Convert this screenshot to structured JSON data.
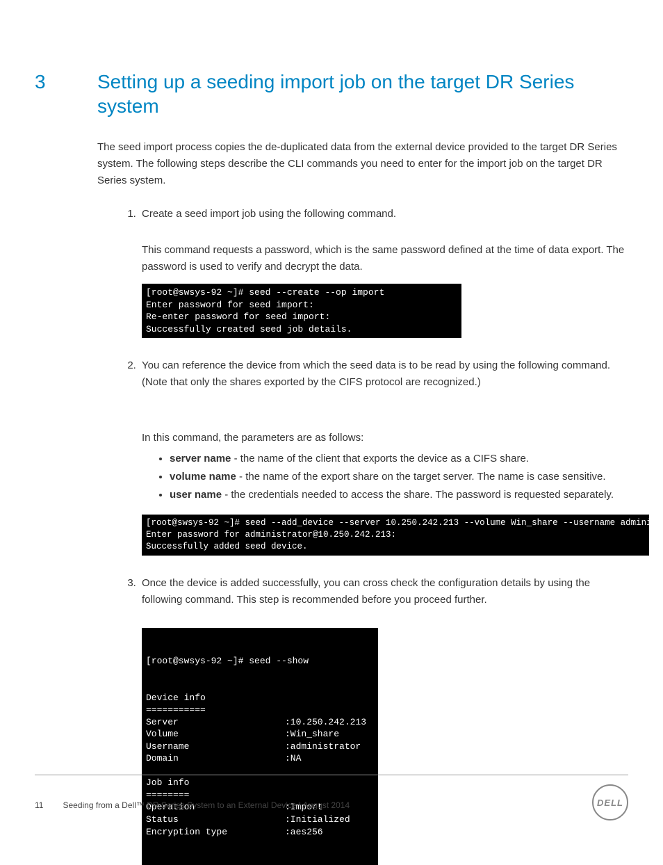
{
  "section": {
    "number": "3",
    "title": "Setting up a seeding import job on the target DR Series system"
  },
  "intro": "The seed import process copies the de-duplicated data from the external device provided to the target DR Series system. The following steps describe the CLI commands you need to enter for the import job on the target DR Series system.",
  "steps": [
    {
      "lead": "Create a seed import job using the following command.",
      "desc": "This command requests a password, which is the same password defined at the time of data export. The password is used to verify and decrypt the data.",
      "terminal": "[root@swsys-92 ~]# seed --create --op import\nEnter password for seed import:\nRe-enter password for seed import:\nSuccessfully created seed job details."
    },
    {
      "lead": "You can reference the device from which the seed data is to be read by using the following command. (Note that only the shares exported by the CIFS protocol are recognized.)",
      "param_intro": "In this command, the parameters are as follows:",
      "params": [
        {
          "name": "server name",
          "desc": " - the name of the client that exports the device as a CIFS share."
        },
        {
          "name": "volume name",
          "desc": " - the name of the export share on the target server. The name is case sensitive."
        },
        {
          "name": "user name",
          "desc": " - the credentials needed to access the share. The password is requested separately."
        }
      ],
      "terminal": "[root@swsys-92 ~]# seed --add_device --server 10.250.242.213 --volume Win_share --username administrator\nEnter password for administrator@10.250.242.213:\nSuccessfully added seed device."
    },
    {
      "lead": "Once the device is added successfully, you can cross check the configuration details by using the following command. This step is recommended before you proceed further.",
      "terminal3": {
        "head": "[root@swsys-92 ~]# seed --show",
        "rows_left": "Device info\n===========\nServer\nVolume\nUsername\nDomain\n\nJob info\n========\nOperation\nStatus\nEncryption type",
        "rows_right": "\n\n:10.250.242.213\n:Win_share\n:administrator\n:NA\n\n\n\n:Import\n:Initialized\n:aes256"
      }
    }
  ],
  "footer": {
    "page_num": "11",
    "doc_title": "Seeding from a Dell™ DR Series System to an External Device | August 2014"
  },
  "logo_text": "DELL"
}
